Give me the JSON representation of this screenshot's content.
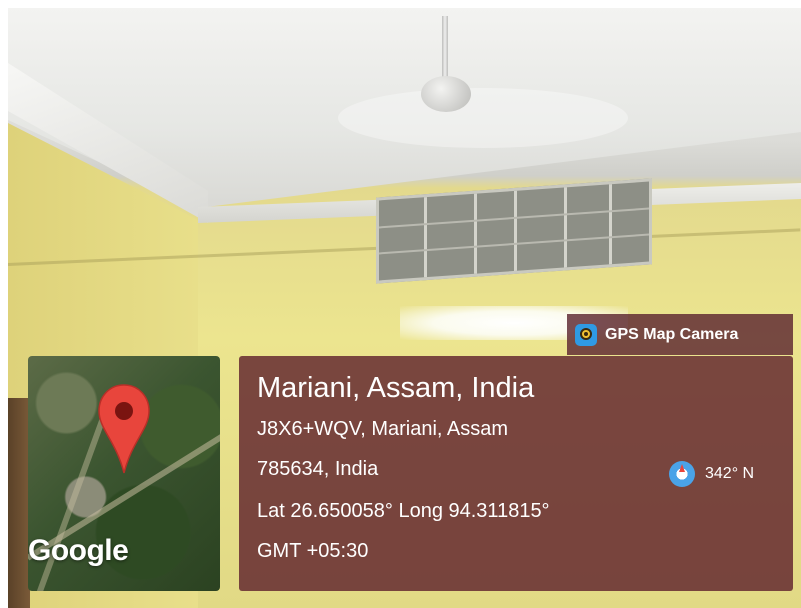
{
  "badge": {
    "app_icon": "gps-map-camera-icon",
    "title": "GPS Map Camera"
  },
  "map": {
    "pin_icon": "map-pin-icon",
    "pin_color": "#e8453c",
    "logo_text": "Google"
  },
  "location": {
    "place": "Mariani, Assam, India",
    "address_line1": "J8X6+WQV, Mariani, Assam",
    "address_line2": "785634, India",
    "coordinates": "Lat 26.650058° Long 94.311815°",
    "timezone": "GMT +05:30"
  },
  "compass": {
    "icon": "compass-icon",
    "heading": "342° N"
  },
  "colors": {
    "panel_bg": "#5c1e2a",
    "text": "#ffffff"
  }
}
